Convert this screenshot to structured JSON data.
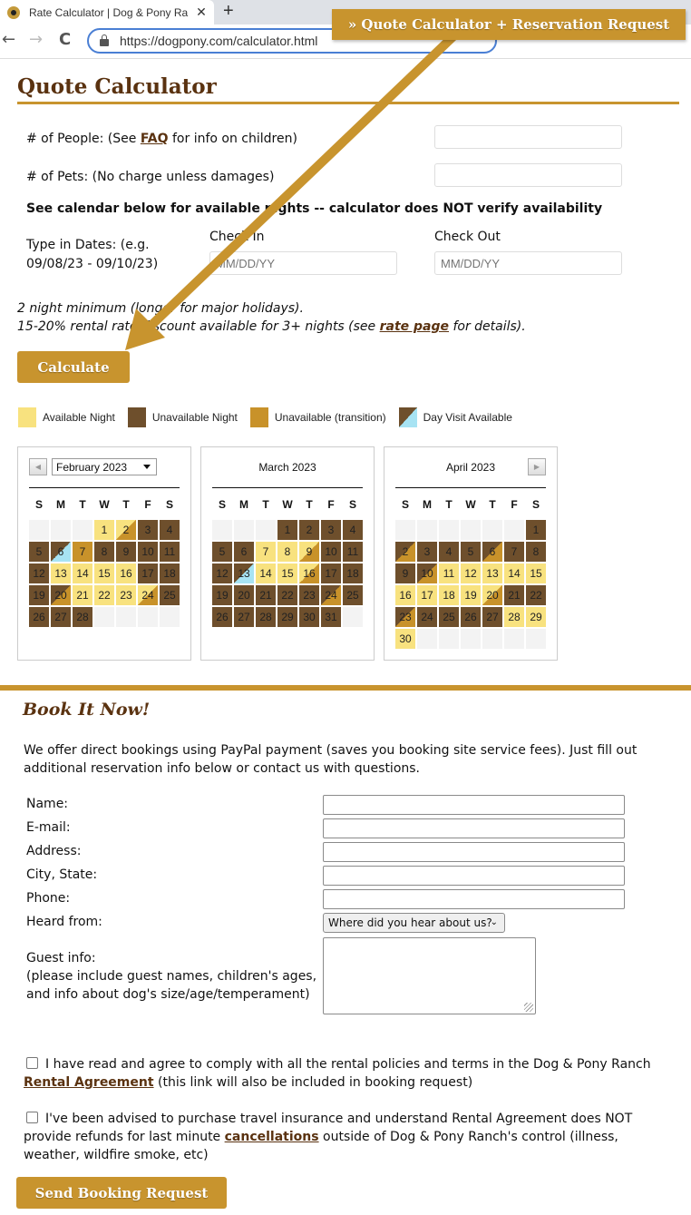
{
  "browser": {
    "tab_title": "Rate Calculator | Dog & Pony Ra",
    "tab_close": "✕",
    "new_tab": "+",
    "back": "←",
    "forward": "→",
    "reload": "C",
    "url": "https://dogpony.com/calculator.html"
  },
  "callout": {
    "label": "» Quote Calculator + Reservation Request",
    "color": "#c8942e"
  },
  "quote": {
    "title": "Quote Calculator",
    "people_label_pre": "# of People: (See ",
    "people_link": "FAQ",
    "people_label_post": " for info on children)",
    "people_value": "",
    "pets_label": "# of Pets: (No charge unless damages)",
    "pets_value": "",
    "availability_note": "See calendar below for available nights -- calculator does NOT verify availability",
    "dates_label_line1": "Type in Dates: (e.g.",
    "dates_label_line2": "09/08/23 - 09/10/23)",
    "checkin_label": "Check In",
    "checkin_placeholder": "MM/DD/YY",
    "checkout_label": "Check Out",
    "checkout_placeholder": "MM/DD/YY",
    "min_note": "2 night minimum (longer for major holidays).",
    "discount_pre": "15-20% rental rate discount available for 3+ nights (see ",
    "discount_link": "rate page",
    "discount_post": " for details).",
    "calculate_button": "Calculate"
  },
  "legend": [
    {
      "label": "Available Night",
      "state": "avail"
    },
    {
      "label": "Unavailable Night",
      "state": "unavail"
    },
    {
      "label": "Unavailable (transition)",
      "state": "trans"
    },
    {
      "label": "Day Visit Available",
      "state": "day"
    }
  ],
  "colors": {
    "available": "#f8e27f",
    "unavailable": "#6e4f2c",
    "transition": "#c8922a",
    "day_visit": "#a7e3f3",
    "accent": "#c8942e",
    "heading": "#5a3210"
  },
  "calendars": {
    "dow": [
      "S",
      "M",
      "T",
      "W",
      "T",
      "F",
      "S"
    ],
    "prev_icon": "◀",
    "next_icon": "▶",
    "months": [
      {
        "title": "February 2023",
        "has_select": true,
        "offset": 3,
        "days": [
          "avail",
          "avail-trans",
          "unavail",
          "unavail",
          "unavail",
          "day",
          "trans",
          "unavail",
          "unavail",
          "unavail",
          "unavail",
          "unavail",
          "avail",
          "avail",
          "avail",
          "avail",
          "unavail",
          "unavail",
          "unavail",
          "unavail-trans",
          "avail",
          "avail",
          "avail",
          "avail-trans",
          "unavail",
          "unavail",
          "unavail",
          "unavail"
        ]
      },
      {
        "title": "March 2023",
        "has_select": false,
        "offset": 3,
        "days": [
          "unavail",
          "unavail",
          "unavail",
          "unavail",
          "unavail",
          "unavail",
          "avail",
          "avail",
          "avail-trans",
          "unavail",
          "unavail",
          "unavail",
          "day",
          "avail",
          "avail",
          "avail-trans",
          "unavail",
          "unavail",
          "unavail",
          "unavail",
          "unavail",
          "unavail",
          "unavail",
          "unavail-trans",
          "unavail",
          "unavail",
          "unavail",
          "unavail",
          "unavail",
          "unavail",
          "unavail"
        ]
      },
      {
        "title": "April 2023",
        "has_select": false,
        "offset": 6,
        "days": [
          "unavail",
          "unavail-trans",
          "unavail",
          "unavail",
          "unavail",
          "unavail-trans",
          "unavail",
          "unavail",
          "unavail",
          "unavail-trans",
          "avail",
          "avail",
          "avail",
          "avail",
          "avail",
          "avail",
          "avail",
          "avail",
          "avail",
          "avail-trans",
          "unavail",
          "unavail",
          "unavail-trans",
          "unavail",
          "unavail",
          "unavail",
          "unavail",
          "avail",
          "avail",
          "avail"
        ]
      }
    ]
  },
  "booking": {
    "title": "Book It Now!",
    "intro": "We offer direct bookings using PayPal payment (saves you booking site service fees). Just fill out additional reservation info below or contact us with questions.",
    "fields": [
      {
        "label": "Name:",
        "value": ""
      },
      {
        "label": "E-mail:",
        "value": ""
      },
      {
        "label": "Address:",
        "value": ""
      },
      {
        "label": "City, State:",
        "value": ""
      },
      {
        "label": "Phone:",
        "value": ""
      }
    ],
    "heard_from_label": "Heard from:",
    "heard_from_selected": "Where did you hear about us?",
    "guest_info_line1": "Guest info:",
    "guest_info_line2": "(please include guest names, children's ages,",
    "guest_info_line3": "and info about dog's size/age/temperament)",
    "guest_info_value": "",
    "agree1_text": "I have read and agree to comply with all the rental policies and terms in the Dog & Pony Ranch ",
    "agree1_link": "Rental Agreement",
    "agree1_post": " (this link will also be included in booking request)",
    "agree1_checked": false,
    "agree2_text": "I've been advised to purchase travel insurance and understand Rental Agreement does NOT provide refunds for last minute ",
    "agree2_link": "cancellations",
    "agree2_post": " outside of Dog & Pony Ranch's control (illness, weather, wildfire smoke, etc)",
    "agree2_checked": false,
    "send_button": "Send Booking Request"
  }
}
